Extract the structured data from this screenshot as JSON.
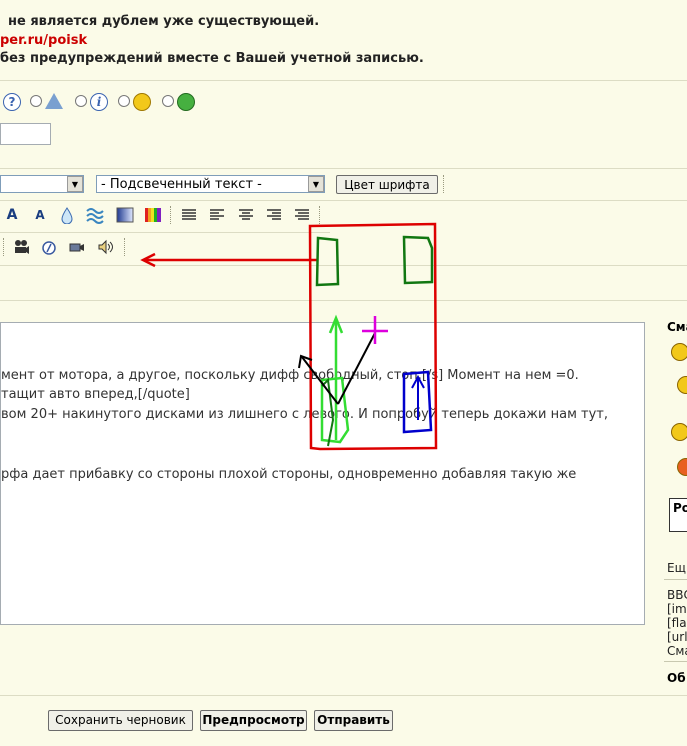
{
  "notices": {
    "line1": "не является дублем уже существующей.",
    "line2": "per.ru/poisk",
    "line3": "без предупреждений вместе с Вашей учетной записью."
  },
  "icons": {
    "question": "question-icon",
    "warning": "warning-icon",
    "info": "info-icon",
    "wink": "wink-smiley-icon",
    "grin": "grin-smiley-icon"
  },
  "toolbar": {
    "font_select": "",
    "highlight_select": "- Подсвеченный текст -",
    "font_color_button": "Цвет шрифта"
  },
  "editor": {
    "line1": "мент от мотора, а другое, поскольку дифф свободный, стоп.[/s] Момент на нем =0.",
    "line2": "тащит авто вперед,[/quote]",
    "line3": "вом 20+ накинутого дисками из лишнего с левого. И попробуй теперь докажи нам тут,",
    "line4": "рфа дает прибавку со стороны плохой стороны, одновременно добавляя такую же"
  },
  "sidebar": {
    "smileys_title": "Сма",
    "box_label": "Ро",
    "more": "Ещ",
    "bbcode": [
      "ВВС",
      "[im",
      "[fla",
      "[url",
      "Сма"
    ],
    "bottom_label": "Об"
  },
  "buttons": {
    "save_draft": "Сохранить черновик",
    "preview": "Предпросмотр",
    "submit": "Отправить"
  },
  "colors": {
    "background": "#fbfbe8",
    "annotation_red": "#dd0000",
    "annotation_green": "#33dd33",
    "annotation_darkgreen": "#117711",
    "annotation_blue": "#0000cc",
    "annotation_magenta": "#dd00dd"
  }
}
